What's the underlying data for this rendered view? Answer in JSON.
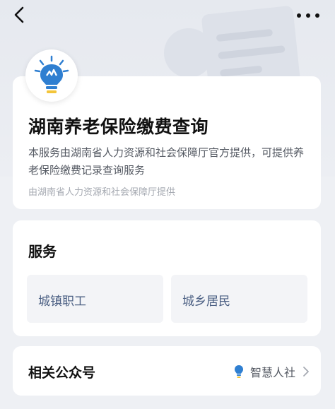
{
  "service": {
    "title": "湖南养老保险缴费查询",
    "description": "本服务由湖南省人力资源和社会保障厅官方提供，可提供养老保险缴费记录查询服务",
    "provider": "由湖南省人力资源和社会保障厅提供",
    "logo_icon": "lightbulb-logo-icon"
  },
  "services_section": {
    "title": "服务",
    "items": [
      {
        "label": "城镇职工"
      },
      {
        "label": "城乡居民"
      }
    ]
  },
  "related_account": {
    "label": "相关公众号",
    "name": "智慧人社",
    "icon": "lightbulb-icon"
  },
  "colors": {
    "tile_text": "#4b5f83",
    "tile_bg": "#f3f4f7",
    "logo_blue": "#2f7fd1",
    "logo_yellow": "#f3c53a"
  }
}
